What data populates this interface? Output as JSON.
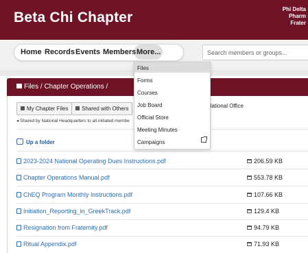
{
  "header": {
    "title": "Beta Chi Chapter",
    "org_lines": [
      "Phi Delta",
      "Pharm",
      "Frater"
    ]
  },
  "nav": {
    "items": [
      "Home",
      "Records",
      "Events",
      "Members",
      "More..."
    ],
    "search_placeholder": "Search members or groups..."
  },
  "dropdown": {
    "items": [
      "Files",
      "Forms",
      "Courses",
      "Job Board",
      "Official Store",
      "Meeting Minutes",
      "Campaigns"
    ],
    "active": "Files",
    "external_icon": "external-link-icon"
  },
  "panel": {
    "breadcrumb": "Files / Chapter Operations /",
    "tabs": [
      "My Chapter Files",
      "Shared with Others",
      "by National Office"
    ],
    "shared_note": "Shared by National Headquarters to all initiated membe",
    "up_label": "Up a folder"
  },
  "files": [
    {
      "name": "2023-2024 National Operating Dues Instructions.pdf",
      "size": "206.59 KB"
    },
    {
      "name": "Chapter Operations Manual.pdf",
      "size": "553.78 KB"
    },
    {
      "name": "ChEQ Program Monthly Instructions.pdf",
      "size": "107.66 KB"
    },
    {
      "name": "Initiation_Reporting_in_GreekTrack.pdf",
      "size": "129.4 KB"
    },
    {
      "name": "Resignation from Fraternity.pdf",
      "size": "94.79 KB"
    },
    {
      "name": "Ritual Appendix.pdf",
      "size": "71.93 KB"
    }
  ],
  "colors": {
    "brand": "#6e1426",
    "link": "#2a6fb5"
  }
}
